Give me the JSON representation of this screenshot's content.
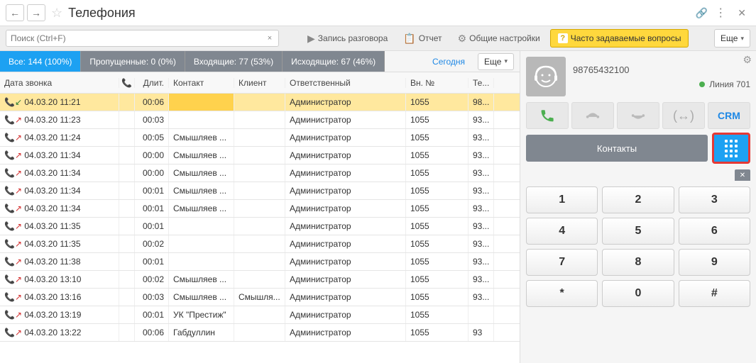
{
  "title": "Телефония",
  "search": {
    "placeholder": "Поиск (Ctrl+F)"
  },
  "toolbar": {
    "record": "Запись разговора",
    "report": "Отчет",
    "settings": "Общие настройки",
    "faq": "Часто задаваемые вопросы",
    "more": "Еще"
  },
  "filters": {
    "all": "Все: 144 (100%)",
    "missed": "Пропущенные: 0 (0%)",
    "incoming": "Входящие: 77 (53%)",
    "outgoing": "Исходящие: 67 (46%)",
    "today": "Сегодня",
    "more": "Еще"
  },
  "columns": {
    "date": "Дата звонка",
    "duration": "Длит.",
    "contact": "Контакт",
    "client": "Клиент",
    "responsible": "Ответственный",
    "ext": "Вн. №",
    "tel": "Те..."
  },
  "rows": [
    {
      "dir": "in",
      "date": "04.03.20 11:21",
      "dur": "00:06",
      "contact": "",
      "client": "",
      "resp": "Администратор",
      "ext": "1055",
      "tel": "98..."
    },
    {
      "dir": "out",
      "date": "04.03.20 11:23",
      "dur": "00:03",
      "contact": "",
      "client": "",
      "resp": "Администратор",
      "ext": "1055",
      "tel": "93..."
    },
    {
      "dir": "out",
      "date": "04.03.20 11:24",
      "dur": "00:05",
      "contact": "Смышляев ...",
      "client": "",
      "resp": "Администратор",
      "ext": "1055",
      "tel": "93..."
    },
    {
      "dir": "out",
      "date": "04.03.20 11:34",
      "dur": "00:00",
      "contact": "Смышляев ...",
      "client": "",
      "resp": "Администратор",
      "ext": "1055",
      "tel": "93..."
    },
    {
      "dir": "out",
      "date": "04.03.20 11:34",
      "dur": "00:00",
      "contact": "Смышляев ...",
      "client": "",
      "resp": "Администратор",
      "ext": "1055",
      "tel": "93..."
    },
    {
      "dir": "out",
      "date": "04.03.20 11:34",
      "dur": "00:01",
      "contact": "Смышляев ...",
      "client": "",
      "resp": "Администратор",
      "ext": "1055",
      "tel": "93..."
    },
    {
      "dir": "out",
      "date": "04.03.20 11:34",
      "dur": "00:01",
      "contact": "Смышляев ...",
      "client": "",
      "resp": "Администратор",
      "ext": "1055",
      "tel": "93..."
    },
    {
      "dir": "out",
      "date": "04.03.20 11:35",
      "dur": "00:01",
      "contact": "",
      "client": "",
      "resp": "Администратор",
      "ext": "1055",
      "tel": "93..."
    },
    {
      "dir": "out",
      "date": "04.03.20 11:35",
      "dur": "00:02",
      "contact": "",
      "client": "",
      "resp": "Администратор",
      "ext": "1055",
      "tel": "93..."
    },
    {
      "dir": "out",
      "date": "04.03.20 11:38",
      "dur": "00:01",
      "contact": "",
      "client": "",
      "resp": "Администратор",
      "ext": "1055",
      "tel": "93..."
    },
    {
      "dir": "out",
      "date": "04.03.20 13:10",
      "dur": "00:02",
      "contact": "Смышляев ...",
      "client": "",
      "resp": "Администратор",
      "ext": "1055",
      "tel": "93..."
    },
    {
      "dir": "out",
      "date": "04.03.20 13:16",
      "dur": "00:03",
      "contact": "Смышляев ...",
      "client": "Смышля...",
      "resp": "Администратор",
      "ext": "1055",
      "tel": "93..."
    },
    {
      "dir": "out",
      "date": "04.03.20 13:19",
      "dur": "00:01",
      "contact": "УК \"Престиж\"",
      "client": "",
      "resp": "Администратор",
      "ext": "1055",
      "tel": ""
    },
    {
      "dir": "out",
      "date": "04.03.20 13:22",
      "dur": "00:06",
      "contact": "Габдуллин",
      "client": "",
      "resp": "Администратор",
      "ext": "1055",
      "tel": "93"
    }
  ],
  "panel": {
    "number": "98765432100",
    "line": "Линия 701",
    "crm": "CRM",
    "contacts": "Контакты"
  },
  "keys": [
    "1",
    "2",
    "3",
    "4",
    "5",
    "6",
    "7",
    "8",
    "9",
    "*",
    "0",
    "#"
  ]
}
